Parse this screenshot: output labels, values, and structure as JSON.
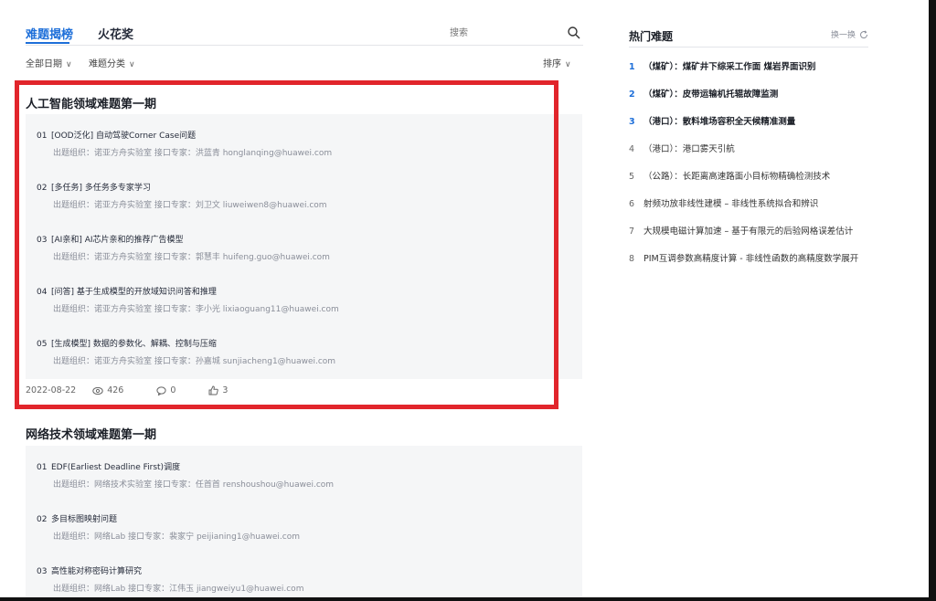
{
  "tabs": [
    {
      "label": "难题揭榜",
      "active": true
    },
    {
      "label": "火花奖",
      "active": false
    }
  ],
  "search": {
    "placeholder": "搜索"
  },
  "filters": {
    "date": "全部日期",
    "category": "难题分类",
    "sort": "排序"
  },
  "sections": [
    {
      "title": "人工智能领域难题第一期",
      "items": [
        {
          "num": "01",
          "title": "[OOD泛化] 自动驾驶Corner Case问题",
          "sub": "出题组织：诺亚方舟实验室 接口专家：洪蓝青 honglanqing@huawei.com"
        },
        {
          "num": "02",
          "title": "[多任务] 多任务多专家学习",
          "sub": "出题组织：诺亚方舟实验室 接口专家：刘卫文 liuweiwen8@huawei.com"
        },
        {
          "num": "03",
          "title": "[AI亲和] AI芯片亲和的推荐广告模型",
          "sub": "出题组织：诺亚方舟实验室 接口专家：郭慧丰 huifeng.guo@huawei.com"
        },
        {
          "num": "04",
          "title": "[问答] 基于生成模型的开放域知识问答和推理",
          "sub": "出题组织：诺亚方舟实验室 接口专家：李小光 lixiaoguang11@huawei.com"
        },
        {
          "num": "05",
          "title": "[生成模型] 数据的参数化、解耦、控制与压缩",
          "sub": "出题组织：诺亚方舟实验室 接口专家：孙嘉城 sunjiacheng1@huawei.com"
        }
      ],
      "meta": {
        "date": "2022-08-22",
        "views": "426",
        "comments": "0",
        "likes": "3"
      }
    },
    {
      "title": "网络技术领域难题第一期",
      "items": [
        {
          "num": "01",
          "title": "EDF(Earliest Deadline First)调度",
          "sub": "出题组织：网络技术实验室 接口专家：任首首 renshoushou@huawei.com"
        },
        {
          "num": "02",
          "title": "多目标图映射问题",
          "sub": "出题组织：网络Lab 接口专家：裴家宁 peijianing1@huawei.com"
        },
        {
          "num": "03",
          "title": "高性能对称密码计算研究",
          "sub": "出题组织：网络Lab 接口专家：江伟玉 jiangweiyu1@huawei.com"
        }
      ]
    }
  ],
  "hot": {
    "title": "热门难题",
    "refresh": "换一换",
    "items": [
      {
        "rank": "1",
        "text": "（煤矿）：煤矿井下综采工作面 煤岩界面识别"
      },
      {
        "rank": "2",
        "text": "（煤矿）：皮带运输机托辊故障监测"
      },
      {
        "rank": "3",
        "text": "（港口）：散料堆场容积全天候精准测量"
      },
      {
        "rank": "4",
        "text": "（港口）：港口雾天引航"
      },
      {
        "rank": "5",
        "text": "（公路）：长距离高速路面小目标物精确检测技术"
      },
      {
        "rank": "6",
        "text": "射频功放非线性建模 – 非线性系统拟合和辨识"
      },
      {
        "rank": "7",
        "text": "大规模电磁计算加速 – 基于有限元的后验网格误差估计"
      },
      {
        "rank": "8",
        "text": "PIM互调参数高精度计算 - 非线性函数的高精度数学展开"
      }
    ]
  },
  "colors": {
    "accent": "#1e6fd9",
    "highlight": "#e1252b"
  }
}
